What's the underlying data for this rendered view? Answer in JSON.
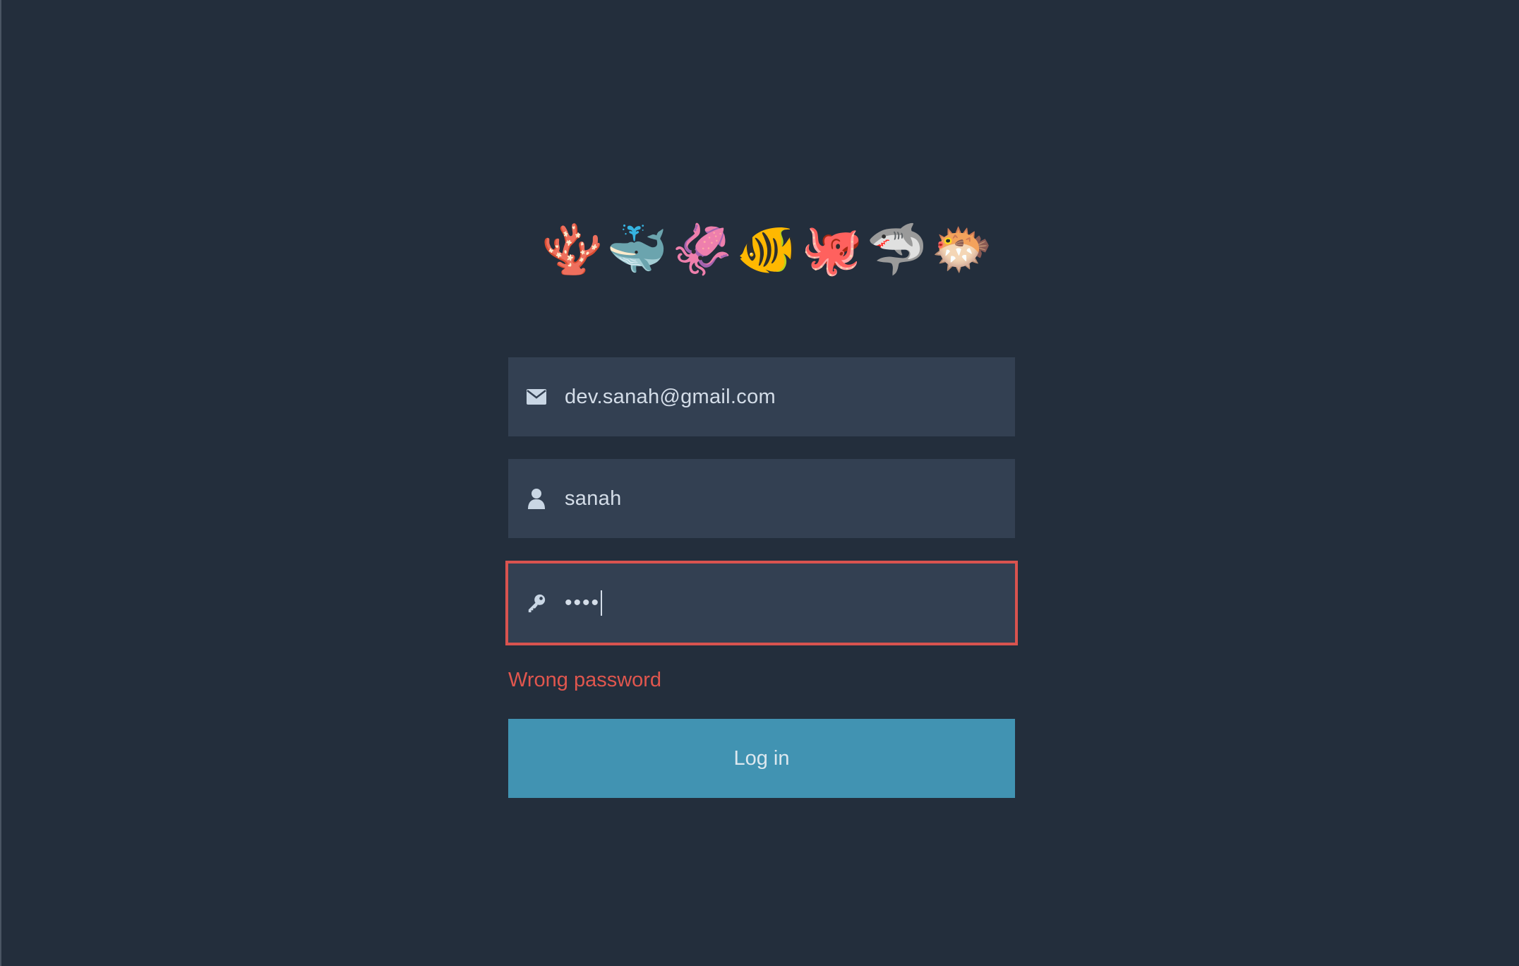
{
  "header": {
    "emojis": [
      {
        "name": "coral-icon",
        "glyph": "🪸"
      },
      {
        "name": "whale-icon",
        "glyph": "🐳"
      },
      {
        "name": "squid-icon",
        "glyph": "🦑"
      },
      {
        "name": "tropical-fish-icon",
        "glyph": "🐠"
      },
      {
        "name": "octopus-icon",
        "glyph": "🐙"
      },
      {
        "name": "shark-icon",
        "glyph": "🦈"
      },
      {
        "name": "blowfish-icon",
        "glyph": "🐡"
      }
    ]
  },
  "form": {
    "email": {
      "value": "dev.sanah@gmail.com",
      "icon": "envelope-icon"
    },
    "username": {
      "value": "sanah",
      "icon": "user-icon"
    },
    "password": {
      "masked_value": "••••",
      "icon": "key-icon"
    },
    "error_message": "Wrong password",
    "submit_label": "Log in"
  },
  "colors": {
    "background": "#232e3c",
    "field_background": "#334052",
    "error": "#e0564e",
    "button": "#4193b2"
  }
}
